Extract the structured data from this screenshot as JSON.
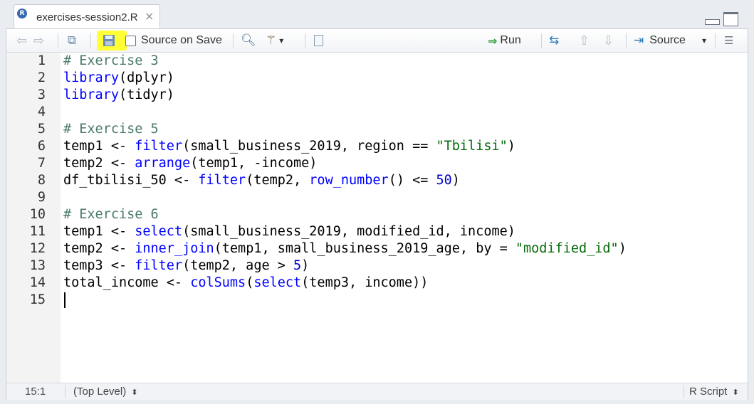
{
  "tab": {
    "filename": "exercises-session2.R",
    "close": "×",
    "file_badge": "R"
  },
  "toolbar": {
    "source_on_save": "Source on Save",
    "run": "Run",
    "source": "Source",
    "source_dropdown": "▾",
    "wand_dropdown": "▾"
  },
  "code_lines": [
    "# Exercise 3",
    "library(dplyr)",
    "library(tidyr)",
    "",
    "# Exercise 5",
    "temp1 <- filter(small_business_2019, region == \"Tbilisi\")",
    "temp2 <- arrange(temp1, -income)",
    "df_tbilisi_50 <- filter(temp2, row_number() <= 50)",
    "",
    "# Exercise 6",
    "temp1 <- select(small_business_2019, modified_id, income)",
    "temp2 <- inner_join(temp1, small_business_2019_age, by = \"modified_id\")",
    "temp3 <- filter(temp2, age > 5)",
    "total_income <- colSums(select(temp3, income))",
    ""
  ],
  "line_numbers": [
    "1",
    "2",
    "3",
    "4",
    "5",
    "6",
    "7",
    "8",
    "9",
    "10",
    "11",
    "12",
    "13",
    "14",
    "15"
  ],
  "status": {
    "position": "15:1",
    "scope": "(Top Level)",
    "scope_arrows": "⬍",
    "file_type": "R Script",
    "file_type_arrows": "⬍"
  },
  "colors": {
    "comment": "#4a7a6a",
    "keyword": "#0000ff",
    "string": "#036a07",
    "number": "#0000cd",
    "highlight": "#ffff33"
  }
}
